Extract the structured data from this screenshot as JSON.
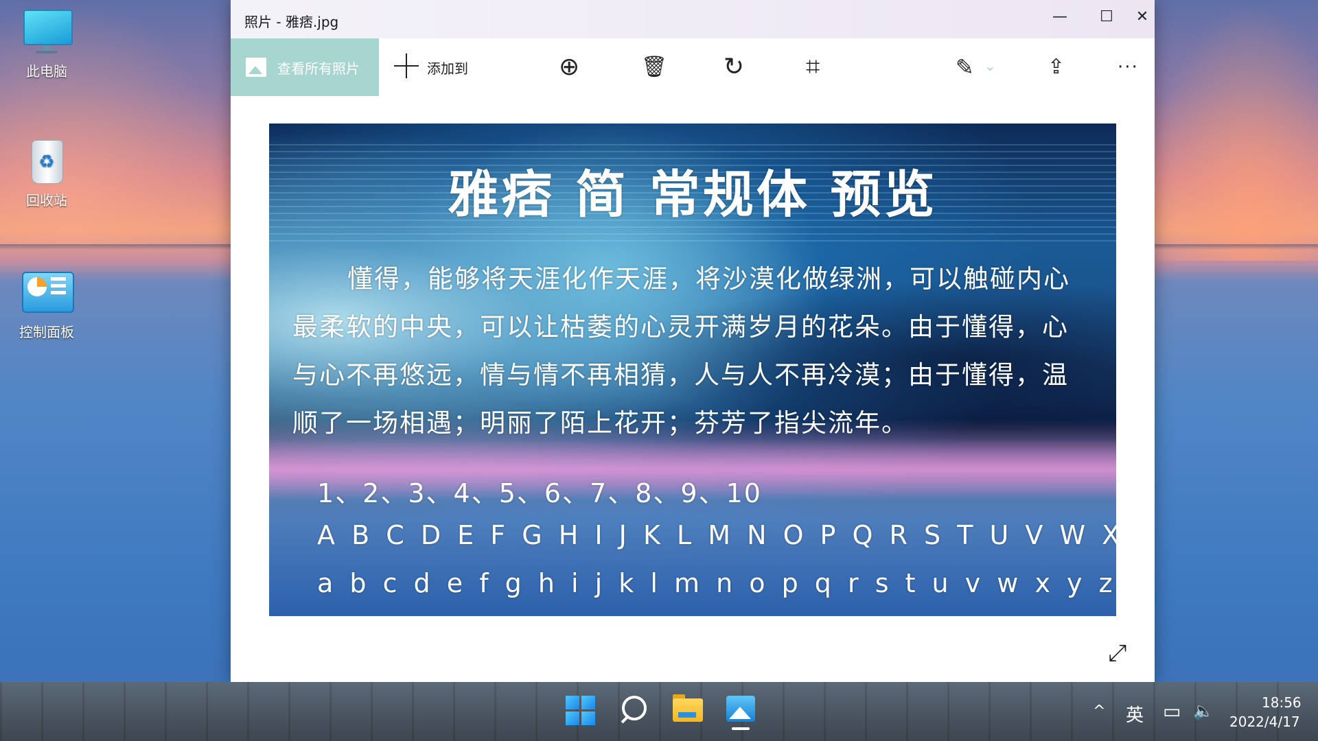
{
  "desktop": {
    "icons": [
      {
        "label": "此电脑",
        "icon": "computer-icon"
      },
      {
        "label": "回收站",
        "icon": "recycle-bin-icon"
      },
      {
        "label": "控制面板",
        "icon": "control-panel-icon"
      }
    ]
  },
  "window": {
    "title": "照片 - 雅痞.jpg",
    "minimize_glyph": "—",
    "maximize_glyph": "☐",
    "close_glyph": "✕"
  },
  "toolbar": {
    "see_all_label": "查看所有照片",
    "add_to_label": "添加到",
    "zoom_glyph": "⊕",
    "delete_glyph": "🗑",
    "rotate_glyph": "↻",
    "crop_glyph": "⌗",
    "edit_glyph": "✎",
    "edit_dropdown_glyph": "⌄",
    "share_glyph": "⇪",
    "more_glyph": "···"
  },
  "image": {
    "title": "雅痞 简 常规体 预览",
    "lines": [
      "懂得，能够将天涯化作天涯，将沙漠化做绿洲，可以触碰内心",
      "最柔软的中央，可以让枯萎的心灵开满岁月的花朵。由于懂得，心",
      "与心不再悠远，情与情不再相猜，人与人不再冷漠；由于懂得，温",
      "顺了一场相遇；明丽了陌上花开；芬芳了指尖流年。"
    ],
    "numbers": "1、2、3、4、5、6、7、8、9、10",
    "uppercase": "A B C D E F G H I J K L M N O P Q R S T U V W X YZ",
    "lowercase": "a b c d e f g h i j k l m n o p q r s t u v w x y z"
  },
  "fullscreen_glyph": "⤢",
  "taskbar": {
    "apps": [
      "start-icon",
      "search-icon",
      "file-explorer-icon",
      "photos-icon"
    ],
    "tray": {
      "chevron": "^",
      "ime": "英",
      "network_glyph": "▭",
      "volume_glyph": "🔈"
    },
    "time": "18:56",
    "date": "2022/4/17"
  },
  "colors": {
    "accent_button": "#a7d5cf",
    "window_bg": "#ffffff"
  }
}
